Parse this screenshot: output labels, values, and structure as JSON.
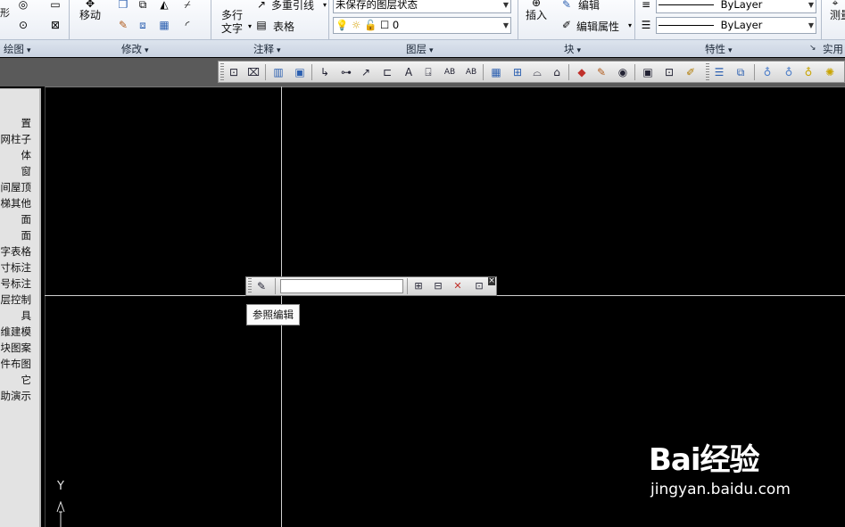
{
  "ribbon": {
    "panels": [
      {
        "label": "绘图"
      },
      {
        "label": "修改"
      },
      {
        "label": "注释"
      },
      {
        "label": "图层"
      },
      {
        "label": "块"
      },
      {
        "label": "特性"
      },
      {
        "label": "实用"
      }
    ],
    "modify": {
      "move_label": "移动"
    },
    "annotation": {
      "multiline_text_label": "多行",
      "text_label": "文字",
      "multileader_label": "多重引线",
      "table_label": "表格"
    },
    "layers": {
      "layer_state": "未保存的图层状态",
      "current_layer": "0"
    },
    "block": {
      "insert_label": "插入",
      "edit_label": "编辑",
      "edit_attributes_label": "编辑属性"
    },
    "properties": {
      "color": "ByLayer",
      "linetype": "ByLayer"
    },
    "utilities": {
      "measure_label": "测量"
    }
  },
  "palette": {
    "items": [
      "置",
      "网柱子",
      "体",
      "窗",
      "间屋顶",
      "梯其他",
      "面",
      "面",
      "字表格",
      "寸标注",
      "号标注",
      "层控制",
      "具",
      "维建模",
      "块图案",
      "件布图",
      "它",
      "助演示"
    ]
  },
  "refedit": {
    "tooltip": "参照编辑",
    "name_value": ""
  },
  "ucs": {
    "axis_label": "Y"
  },
  "watermark": {
    "logo": "Bai经验",
    "url": "jingyan.baidu.com"
  }
}
